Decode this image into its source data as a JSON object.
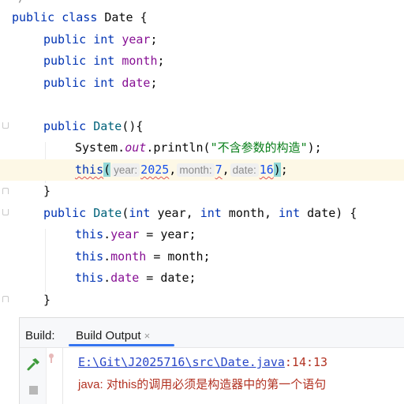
{
  "editor": {
    "top_fragment": "*/",
    "lines": {
      "class_decl": {
        "kw1": "public",
        "kw2": "class",
        "name": "Date",
        "brace": "{"
      },
      "field_year": {
        "kw1": "public",
        "kw2": "int",
        "field": "year",
        "end": ";"
      },
      "field_month": {
        "kw1": "public",
        "kw2": "int",
        "field": "month",
        "end": ";"
      },
      "field_date": {
        "kw1": "public",
        "kw2": "int",
        "field": "date",
        "end": ";"
      },
      "ctor1_decl": {
        "kw": "public",
        "name": "Date",
        "rest": "(){"
      },
      "println": {
        "obj": "System.",
        "out": "out",
        "call": ".println(",
        "string": "\"不含参数的构造\"",
        "end": ");"
      },
      "this_call": {
        "kw": "this",
        "open": "(",
        "hint_year": "year:",
        "val_year": "2025",
        "comma1": ",",
        "hint_month": "month:",
        "val_month": "7",
        "comma2": ",",
        "hint_date": "date:",
        "val_date": "16",
        "close": ")",
        "end": ";"
      },
      "ctor1_close": "}",
      "ctor2_decl": {
        "kw1": "public",
        "name": "Date",
        "p1": "(",
        "t1": "int",
        "a1": " year, ",
        "t2": "int",
        "a2": " month, ",
        "t3": "int",
        "a3": " date) {"
      },
      "assign_year": {
        "kw": "this",
        "dot": ".",
        "field": "year",
        "rest": " = year;"
      },
      "assign_month": {
        "kw": "this",
        "dot": ".",
        "field": "month",
        "rest": " = month;"
      },
      "assign_date": {
        "kw": "this",
        "dot": ".",
        "field": "date",
        "rest": " = date;"
      },
      "ctor2_close": "}"
    }
  },
  "build_panel": {
    "title": "Build:",
    "tab_label": "Build Output",
    "tab_close": "×",
    "output": {
      "file_path": "E:\\Git\\J2025716\\src\\Date.java",
      "location": ":14:13",
      "error_message": "java: 对this的调用必须是构造器中的第一个语句"
    }
  },
  "colors": {
    "keyword": "#0033b3",
    "field": "#871094",
    "string": "#067d17",
    "number": "#1750eb",
    "error": "#b23222",
    "link": "#2846c8",
    "tab_accent": "#3574f0",
    "hammer": "#3f9b3c"
  },
  "icons": [
    "hammer-icon",
    "stop-icon",
    "error-tree-icon",
    "close-icon"
  ]
}
